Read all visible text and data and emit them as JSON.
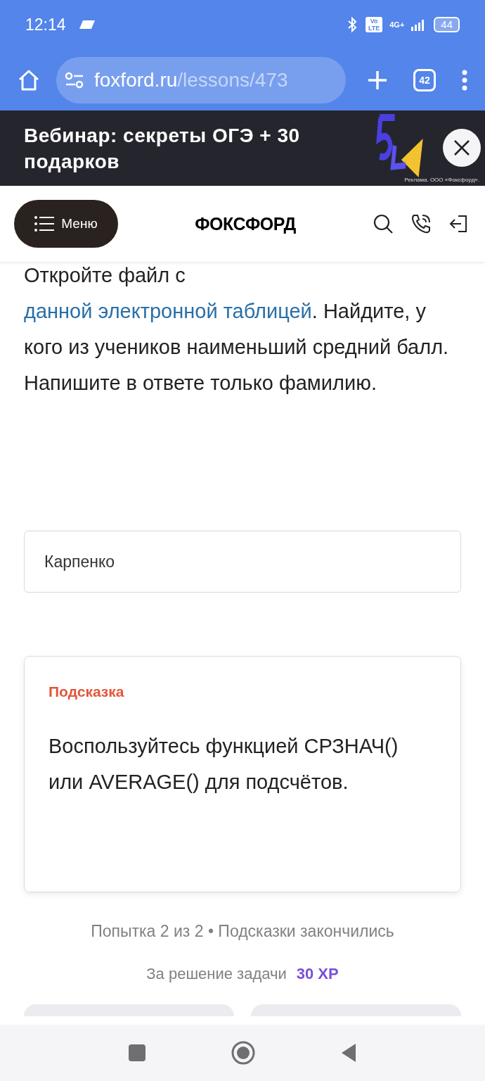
{
  "status_bar": {
    "time": "12:14",
    "volte": "Vo LTE",
    "network": "4G+",
    "battery": "44"
  },
  "browser": {
    "url_host": "foxford.ru",
    "url_path": "/lessons/473",
    "tab_count": "42"
  },
  "ad": {
    "title": "Вебинар: секреты ОГЭ + 30 подарков",
    "disclaimer": "Реклама. ООО «Фоксфорд»."
  },
  "header": {
    "menu_label": "Меню",
    "logo": "ФОКСФОРД"
  },
  "task": {
    "text_before": "Откройте файл с",
    "link": "данной электронной таблицей",
    "text_after": ". Найдите, у кого из учеников наименьший средний балл. Напишите в ответе только фамилию."
  },
  "answer": {
    "value": "Карпенко"
  },
  "hint": {
    "title": "Подсказка",
    "text": "Воспользуйтесь функцией СРЗНАЧ() или AVERAGE() для подсчётов."
  },
  "attempts": "Попытка 2 из 2 • Подсказки закончились",
  "reward": {
    "label": "За решение задачи",
    "value": "30 XP"
  }
}
